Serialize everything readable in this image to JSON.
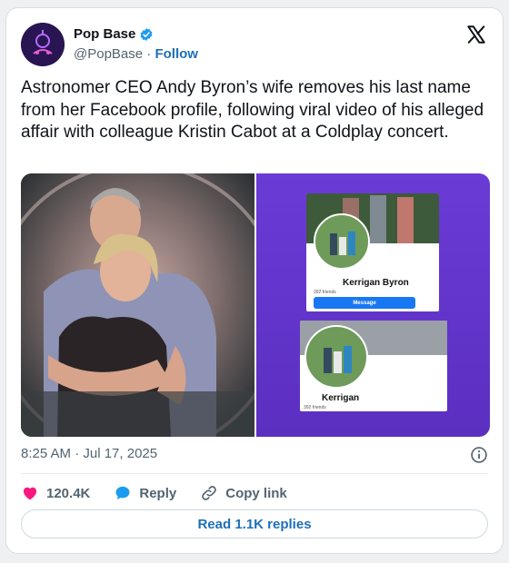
{
  "author": {
    "name": "Pop Base",
    "handle": "@PopBase",
    "separator": "·",
    "follow_label": "Follow"
  },
  "tweet": {
    "text": "Astronomer CEO Andy Byron’s wife removes his last name from her Facebook profile, following viral video of his alleged affair with colleague Kristin Cabot at a Coldplay concert.",
    "timestamp": "8:25 AM · Jul 17, 2025"
  },
  "media": {
    "right": {
      "profile_top_name": "Kerrigan Byron",
      "profile_top_friends": "392 friends",
      "profile_top_button": "Message",
      "profile_bottom_name": "Kerrigan",
      "profile_bottom_friends": "392 friends"
    }
  },
  "actions": {
    "like_count": "120.4K",
    "reply_label": "Reply",
    "copy_link_label": "Copy link"
  },
  "read_replies_label": "Read 1.1K replies",
  "icons": [
    "verified-badge-icon",
    "x-logo-icon",
    "info-icon",
    "heart-icon",
    "reply-bubble-icon",
    "link-icon"
  ],
  "colors": {
    "accent": "#1d6fb8",
    "like": "#f91880",
    "muted": "#536471",
    "verified": "#1d9bf0"
  }
}
